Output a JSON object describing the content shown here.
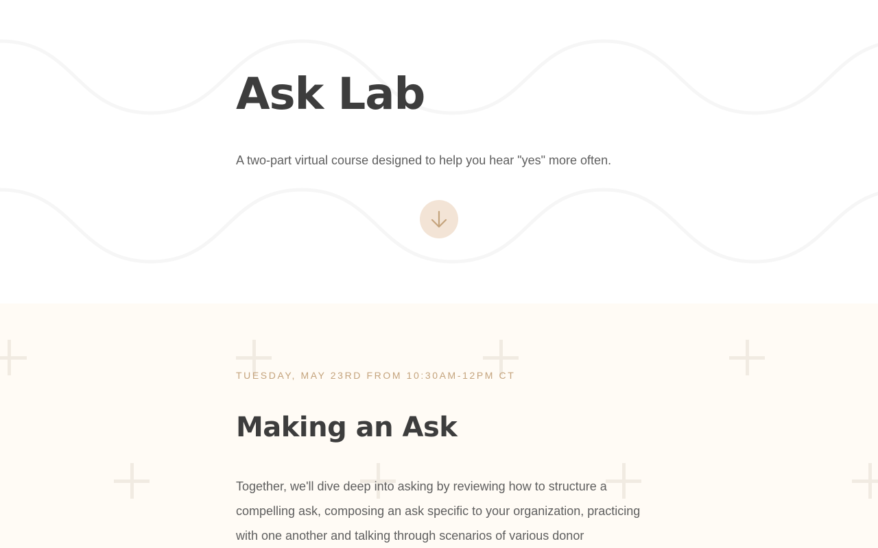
{
  "hero": {
    "title": "Ask Lab",
    "subtitle": "A two-part virtual course designed to help you hear \"yes\" more often.",
    "scroll_icon": "arrow-down-icon"
  },
  "event": {
    "date": "Tuesday, May 23rd from 10:30am-12pm CT",
    "title": "Making an Ask",
    "description": "Together, we'll dive deep into asking by reviewing how to structure a compelling ask, composing an ask specific to your organization, practicing with one another and talking through scenarios of various donor responses.",
    "decoration_icon": "plus-icon"
  },
  "colors": {
    "heading": "#3d3d3d",
    "body_text": "#5e5e5e",
    "accent": "#c4a37c",
    "scroll_button_bg": "#f3e4d6",
    "section_bg": "#fffbf5"
  }
}
